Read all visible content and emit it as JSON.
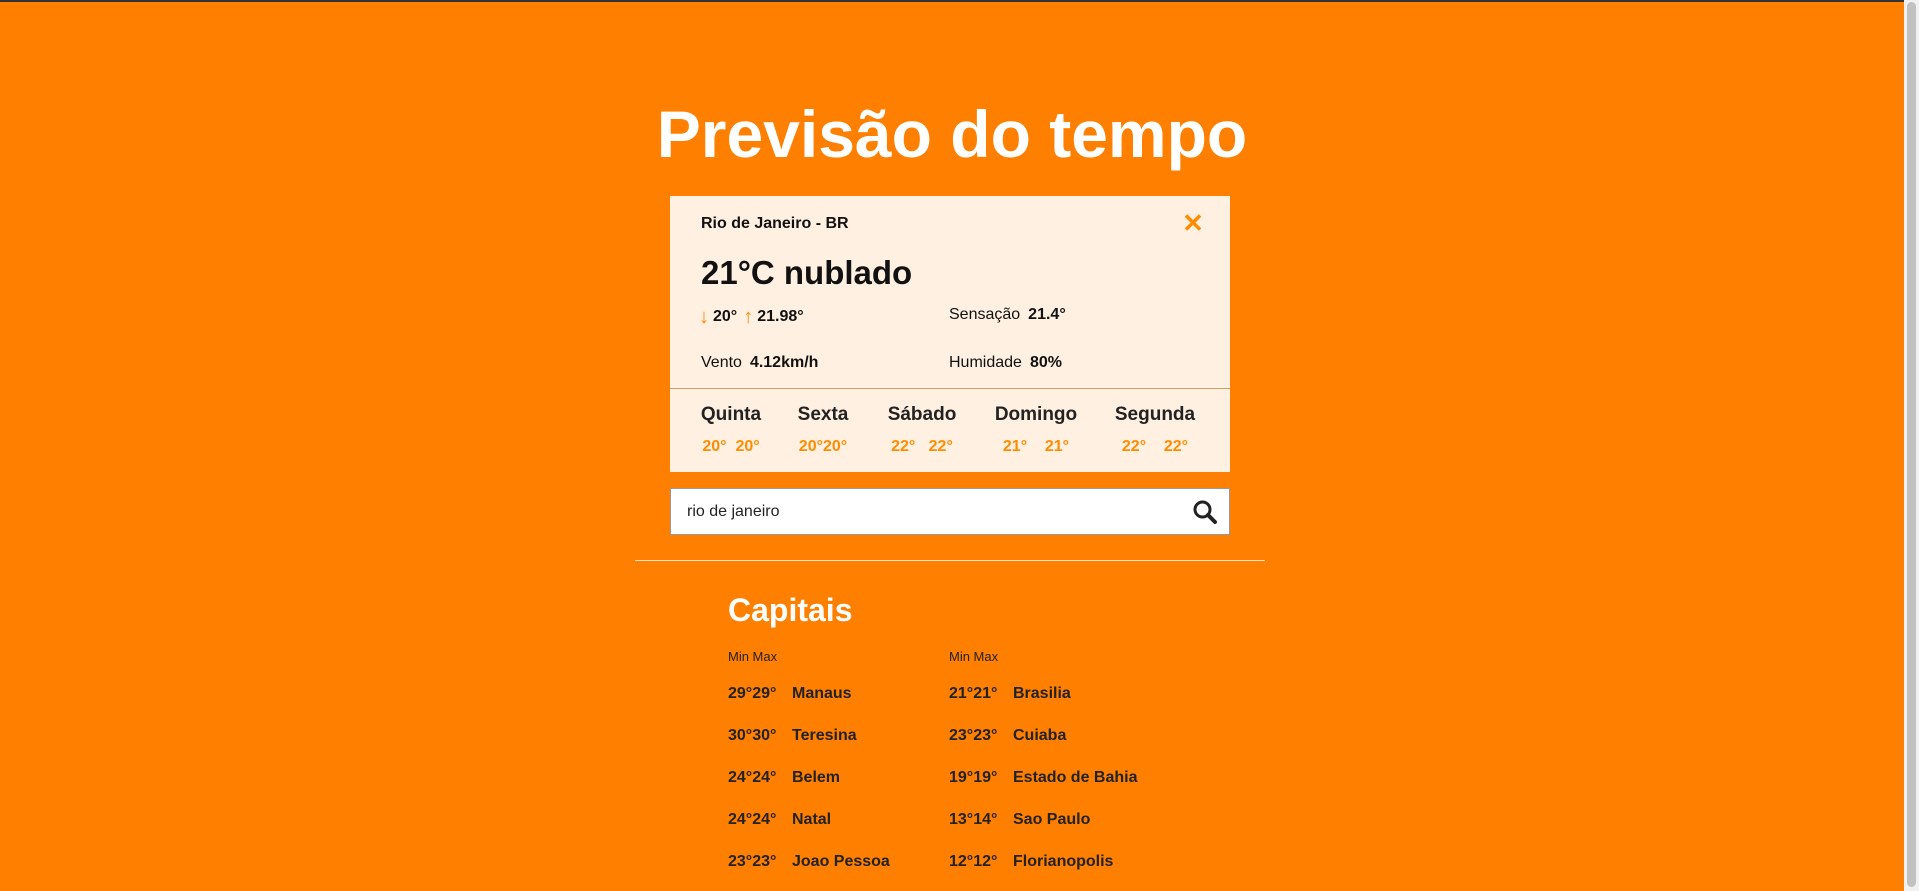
{
  "title": "Previsão do tempo",
  "current": {
    "city": "Rio de Janeiro - BR",
    "temperature": "21°C nublado",
    "min": "20°",
    "max": "21.98°",
    "feels_label": "Sensação",
    "feels_value": "21.4°",
    "wind_label": "Vento",
    "wind_value": "4.12km/h",
    "humidity_label": "Humidade",
    "humidity_value": "80%"
  },
  "forecast": [
    {
      "day": "Quinta",
      "temps": "20°  20°"
    },
    {
      "day": "Sexta",
      "temps": "20°20°"
    },
    {
      "day": "Sábado",
      "temps": "22°   22°"
    },
    {
      "day": "Domingo",
      "temps": "21°    21°"
    },
    {
      "day": "Segunda",
      "temps": "22°    22°"
    }
  ],
  "search": {
    "value": "rio de janeiro"
  },
  "capitals": {
    "title": "Capitais",
    "header": "Min Max",
    "left": [
      {
        "temps": "29°29°",
        "city": "Manaus"
      },
      {
        "temps": "30°30°",
        "city": "Teresina"
      },
      {
        "temps": "24°24°",
        "city": "Belem"
      },
      {
        "temps": "24°24°",
        "city": "Natal"
      },
      {
        "temps": "23°23°",
        "city": "Joao Pessoa"
      }
    ],
    "right": [
      {
        "temps": "21°21°",
        "city": "Brasilia"
      },
      {
        "temps": "23°23°",
        "city": "Cuiaba"
      },
      {
        "temps": "19°19°",
        "city": "Estado de Bahia"
      },
      {
        "temps": "13°14°",
        "city": "Sao Paulo"
      },
      {
        "temps": "12°12°",
        "city": "Florianopolis"
      }
    ]
  },
  "colors": {
    "background": "#ff7f00",
    "card": "#fff0e1",
    "accent": "#ff8c00"
  },
  "icons": {
    "close": "close-icon",
    "search": "search-icon",
    "down": "arrow-down-icon",
    "up": "arrow-up-icon"
  }
}
